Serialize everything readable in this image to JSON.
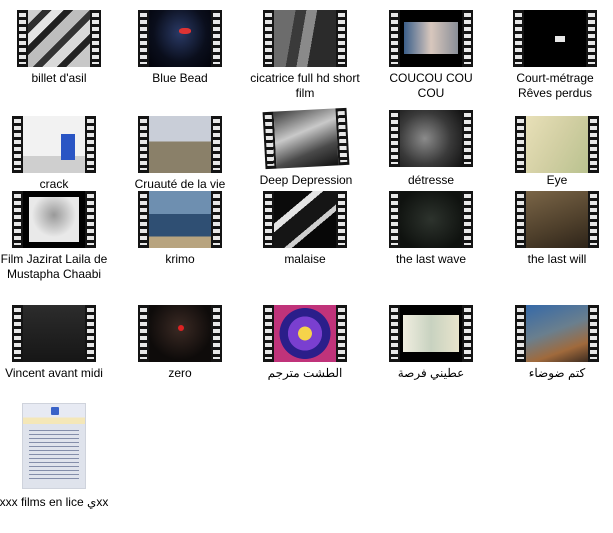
{
  "items": [
    {
      "label": "billet d'asil"
    },
    {
      "label": "Blue Bead"
    },
    {
      "label": "cicatrice full hd short film"
    },
    {
      "label": "COUCOU COU COU"
    },
    {
      "label": "Court-métrage Rêves perdus"
    },
    {
      "label": "crack"
    },
    {
      "label": "Cruauté de la vie"
    },
    {
      "label": "Deep  Depression"
    },
    {
      "label": "détresse"
    },
    {
      "label": "Eye"
    },
    {
      "label": "Film Jazirat Laila de Mustapha Chaabi"
    },
    {
      "label": "krimo"
    },
    {
      "label": "malaise"
    },
    {
      "label": "the last wave"
    },
    {
      "label": "the last will"
    },
    {
      "label": "Vincent avant midi"
    },
    {
      "label": "zero"
    },
    {
      "label": "الطشت مترجم"
    },
    {
      "label": "عطيني فرصة"
    },
    {
      "label": "كتم ضوضاء"
    },
    {
      "label": "xxx films en lice يxx"
    }
  ]
}
